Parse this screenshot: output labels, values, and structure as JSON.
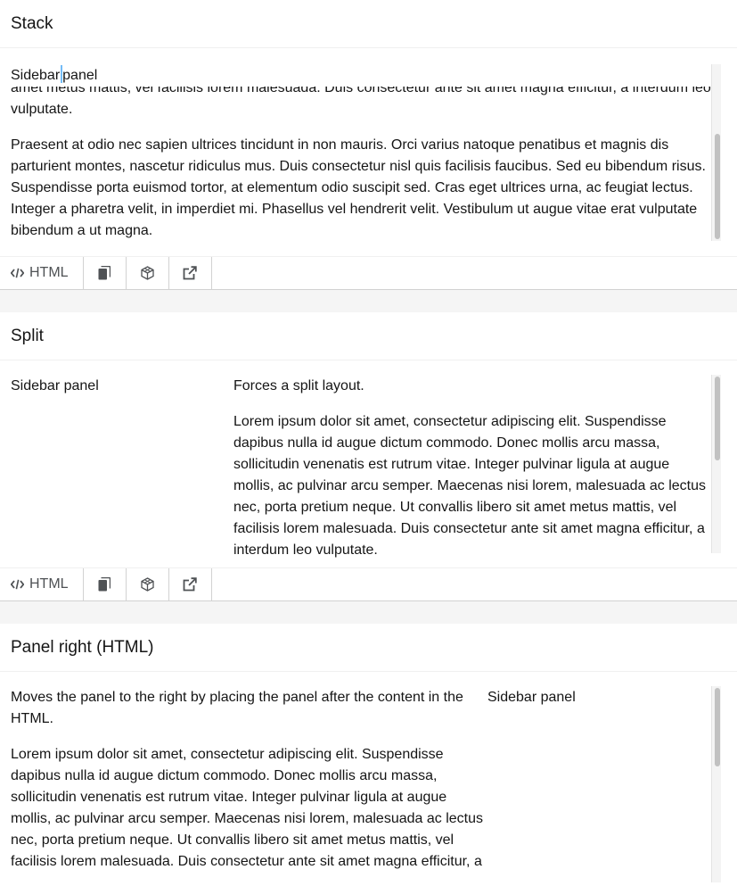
{
  "sections": {
    "stack": {
      "title": "Stack",
      "sidebar_before": "Sidebar",
      "sidebar_after": "panel",
      "overflow_line_1": "amet metus mattis, vel facilisis lorem malesuada. Duis consectetur ante sit amet magna efficitur, a interdum leo",
      "overflow_line_2": "vulputate.",
      "paragraph_lines": [
        "Praesent at odio nec sapien ultrices tincidunt in non mauris. Orci varius natoque penatibus et magnis dis",
        "parturient montes, nascetur ridiculus mus. Duis consectetur nisl quis facilisis faucibus. Sed eu bibendum risus.",
        "Suspendisse porta euismod tortor, at elementum odio suscipit sed. Cras eget ultrices urna, ac feugiat lectus.",
        "Integer a pharetra velit, in imperdiet mi. Phasellus vel hendrerit velit. Vestibulum ut augue vitae erat vulputate",
        "bibendum a ut magna."
      ]
    },
    "split": {
      "title": "Split",
      "sidebar": "Sidebar panel",
      "intro": "Forces a split layout.",
      "paragraph_lines": [
        "Lorem ipsum dolor sit amet, consectetur adipiscing elit. Suspendisse",
        "dapibus nulla id augue dictum commodo. Donec mollis arcu massa,",
        "sollicitudin venenatis est rutrum vitae. Integer pulvinar ligula at augue",
        "mollis, ac pulvinar arcu semper. Maecenas nisi lorem, malesuada ac lectus",
        "nec, porta pretium neque. Ut convallis libero sit amet metus mattis, vel",
        "facilisis lorem malesuada. Duis consectetur ante sit amet magna efficitur, a",
        "interdum leo vulputate."
      ]
    },
    "panel_right": {
      "title": "Panel right (HTML)",
      "sidebar": "Sidebar panel",
      "intro_lines": [
        "Moves the panel to the right by placing the panel after the content in the",
        "HTML."
      ],
      "paragraph_lines": [
        "Lorem ipsum dolor sit amet, consectetur adipiscing elit. Suspendisse",
        "dapibus nulla id augue dictum commodo. Donec mollis arcu massa,",
        "sollicitudin venenatis est rutrum vitae. Integer pulvinar ligula at augue",
        "mollis, ac pulvinar arcu semper. Maecenas nisi lorem, malesuada ac lectus",
        "nec, porta pretium neque. Ut convallis libero sit amet metus mattis, vel",
        "facilisis lorem malesuada. Duis consectetur ante sit amet magna efficitur, a"
      ]
    }
  },
  "toolbar": {
    "html_label": "HTML",
    "icons": [
      "code-icon",
      "copy-icon",
      "codesandbox-icon",
      "external-link-icon"
    ]
  },
  "colors": {
    "text": "#151515",
    "toolbar_text": "#4f5255",
    "divider": "#d2d2d2",
    "gap_bg": "#f5f5f5",
    "caret": "#73bcf7",
    "scroll_thumb": "#c1c1c1"
  }
}
